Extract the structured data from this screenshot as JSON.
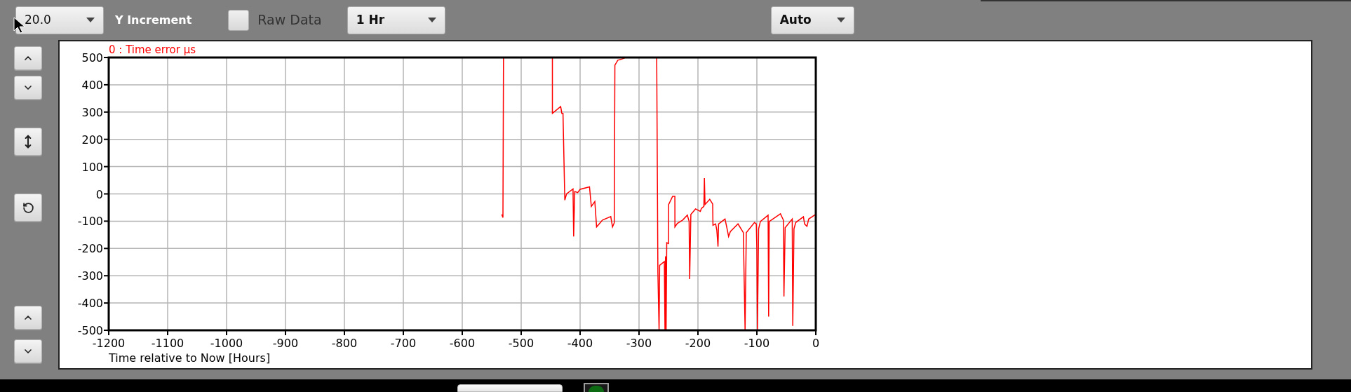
{
  "toolbar": {
    "increment_dropdown": {
      "value": "20.0"
    },
    "increment_label": "Y Increment",
    "raw_data": {
      "label": "Raw Data",
      "checked": false
    },
    "range_dropdown": {
      "value": "1 Hr"
    },
    "scale_dropdown": {
      "value": "Auto"
    }
  },
  "chart": {
    "chart_data": {
      "type": "line",
      "grid": true,
      "xlabel": "Time relative to Now [Hours]",
      "xlim": [
        -1200,
        0
      ],
      "ylim": [
        -500,
        500
      ],
      "xticks": [
        -1200,
        -1100,
        -1000,
        -900,
        -800,
        -700,
        -600,
        -500,
        -400,
        -300,
        -200,
        -100,
        0
      ],
      "yticks": [
        -500,
        -400,
        -300,
        -200,
        -100,
        0,
        100,
        200,
        300,
        400,
        500
      ],
      "x": [
        -533,
        -531,
        -530,
        null,
        -447,
        -447,
        -433,
        -431,
        -429,
        -426,
        -423,
        -412,
        -411,
        -409,
        -404,
        -400,
        -384,
        -381,
        -375,
        -372,
        -366,
        -362,
        -348,
        -345,
        -342,
        -341,
        -336,
        -328,
        -323,
        null,
        -270,
        -268,
        -266,
        -265,
        -257,
        -256,
        -255,
        -254,
        -253,
        -250,
        -249.8,
        -243,
        -239.2,
        -239,
        -235,
        -226,
        -218,
        -215,
        -214,
        -212,
        -204,
        -196,
        -194,
        -190,
        -189,
        -188,
        -180,
        -175,
        -174.5,
        -170,
        -168,
        -166,
        -165,
        -154,
        -151,
        -148,
        -145,
        -132,
        -123,
        -120,
        -118,
        -104,
        -101,
        -100,
        -99,
        -97,
        -94,
        -81,
        -80,
        -79,
        -60,
        -55,
        -54,
        -52,
        -40,
        -39,
        -37,
        -34,
        -21,
        -19,
        -15,
        -12,
        0
      ],
      "series": [
        {
          "name": "0 : Time error µs",
          "color": "#ff0000",
          "values": [
            -75,
            -87,
            500,
            null,
            500,
            295,
            320,
            295,
            295,
            -23,
            0,
            18,
            -156,
            9,
            5,
            17,
            26,
            -46,
            -28,
            -121,
            -106,
            -96,
            -83,
            -121,
            -106,
            472,
            490,
            495,
            500,
            null,
            500,
            -289,
            -500,
            -262,
            -248,
            -500,
            -229,
            -500,
            -179,
            -182,
            -39,
            -9,
            -9,
            -121,
            -108,
            -96,
            -78,
            -101,
            -312,
            -75,
            -55,
            -64,
            -53,
            -46,
            58,
            -39,
            -20,
            -37,
            -115,
            -110,
            -133,
            -193,
            -110,
            -92,
            -124,
            -156,
            -138,
            -110,
            -142,
            -500,
            -142,
            -105,
            -110,
            -206,
            -500,
            -128,
            -101,
            -78,
            -450,
            -101,
            -73,
            -96,
            -376,
            -124,
            -92,
            -484,
            -128,
            -105,
            -84,
            -110,
            -119,
            -92,
            -75
          ]
        }
      ]
    }
  },
  "status_bar": {
    "indicator": {
      "on": true
    }
  }
}
